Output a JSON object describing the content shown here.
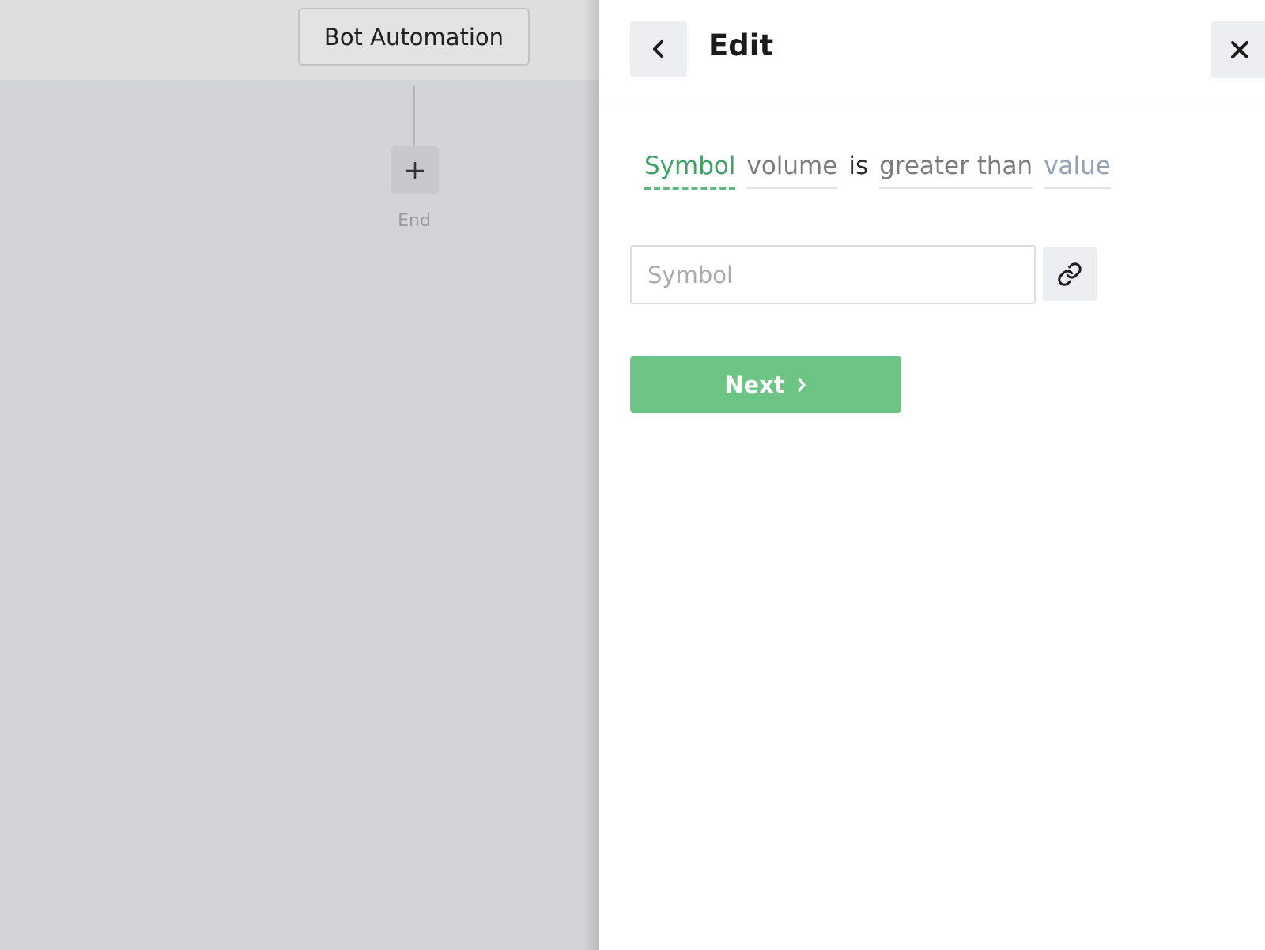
{
  "canvas": {
    "flow_title": "Bot Automation",
    "add_step_icon": "plus-icon",
    "end_label": "End"
  },
  "panel": {
    "back_icon": "chevron-left-icon",
    "title": "Edit",
    "close_icon": "close-icon",
    "condition": {
      "tokens": {
        "subject": "Symbol",
        "metric": "volume",
        "verb": "is",
        "comparator": "greater than",
        "operand": "value"
      }
    },
    "symbol_input": {
      "value": "",
      "placeholder": "Symbol"
    },
    "link_icon": "link-icon",
    "next_button": {
      "label": "Next",
      "icon": "chevron-right-icon"
    }
  },
  "colors": {
    "accent_green": "#6cc485",
    "active_token_green": "#3fa366",
    "canvas_bg": "#d3d4d8"
  }
}
